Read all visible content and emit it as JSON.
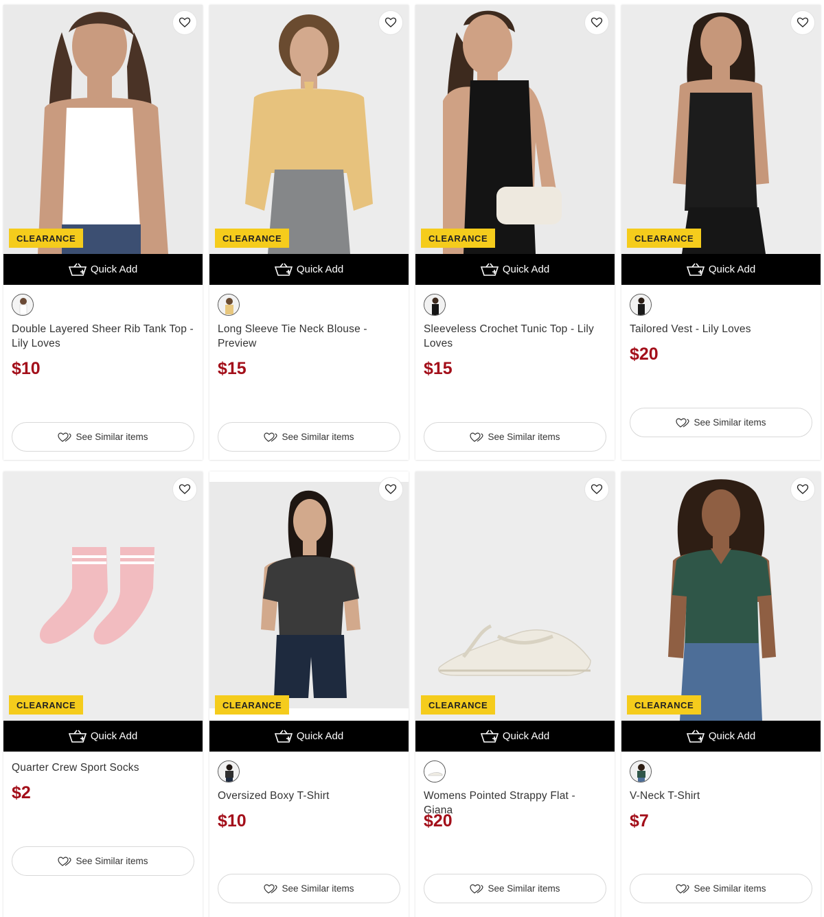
{
  "badge_label": "CLEARANCE",
  "quick_add_label": "Quick Add",
  "see_similar_label": "See Similar items",
  "colors": {
    "badge": "#f5cc1c",
    "price": "#a30f1a",
    "quick_add_bg": "#000000"
  },
  "icons": {
    "heart": "heart-icon",
    "basket": "basket-plus-icon",
    "similar": "hearts-similar-icon"
  },
  "products": [
    {
      "title": "Double Layered Sheer Rib Tank Top - Lily Loves",
      "price": "$10",
      "has_swatch": true,
      "swatch_color": "#f4f4f4"
    },
    {
      "title": "Long Sleeve Tie Neck Blouse - Preview",
      "price": "$15",
      "has_swatch": true,
      "swatch_color": "#e8c77e"
    },
    {
      "title": "Sleeveless Crochet Tunic Top - Lily Loves",
      "price": "$15",
      "has_swatch": true,
      "swatch_color": "#151515"
    },
    {
      "title": "Tailored Vest - Lily Loves",
      "price": "$20",
      "has_swatch": true,
      "swatch_color": "#1a1a1a"
    },
    {
      "title": "Quarter Crew Sport Socks",
      "price": "$2",
      "has_swatch": false,
      "swatch_color": ""
    },
    {
      "title": "Oversized Boxy T-Shirt",
      "price": "$10",
      "has_swatch": true,
      "swatch_color": "#2e2e2e"
    },
    {
      "title": "Womens Pointed Strappy Flat - Giana",
      "price": "$20",
      "has_swatch": true,
      "swatch_color": "#efece4"
    },
    {
      "title": "V-Neck T-Shirt",
      "price": "$7",
      "has_swatch": true,
      "swatch_color": "#2f5648"
    }
  ]
}
